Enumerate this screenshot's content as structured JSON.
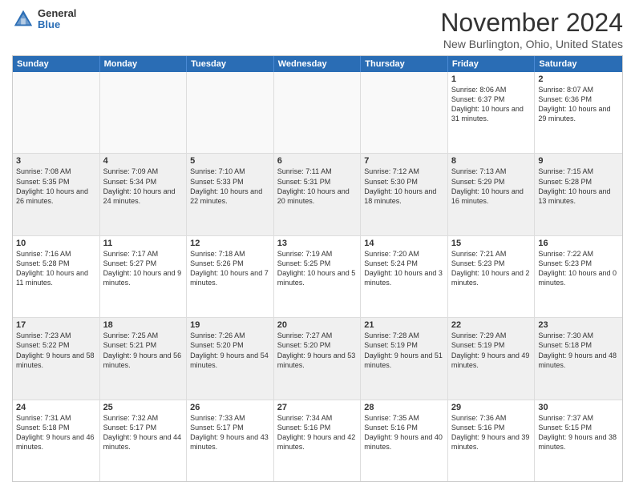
{
  "header": {
    "logo_general": "General",
    "logo_blue": "Blue",
    "month_title": "November 2024",
    "location": "New Burlington, Ohio, United States"
  },
  "calendar": {
    "days_of_week": [
      "Sunday",
      "Monday",
      "Tuesday",
      "Wednesday",
      "Thursday",
      "Friday",
      "Saturday"
    ],
    "rows": [
      [
        {
          "day": "",
          "empty": true
        },
        {
          "day": "",
          "empty": true
        },
        {
          "day": "",
          "empty": true
        },
        {
          "day": "",
          "empty": true
        },
        {
          "day": "",
          "empty": true
        },
        {
          "day": "1",
          "sunrise": "8:06 AM",
          "sunset": "6:37 PM",
          "daylight": "10 hours and 31 minutes."
        },
        {
          "day": "2",
          "sunrise": "8:07 AM",
          "sunset": "6:36 PM",
          "daylight": "10 hours and 29 minutes."
        }
      ],
      [
        {
          "day": "3",
          "sunrise": "7:08 AM",
          "sunset": "5:35 PM",
          "daylight": "10 hours and 26 minutes."
        },
        {
          "day": "4",
          "sunrise": "7:09 AM",
          "sunset": "5:34 PM",
          "daylight": "10 hours and 24 minutes."
        },
        {
          "day": "5",
          "sunrise": "7:10 AM",
          "sunset": "5:33 PM",
          "daylight": "10 hours and 22 minutes."
        },
        {
          "day": "6",
          "sunrise": "7:11 AM",
          "sunset": "5:31 PM",
          "daylight": "10 hours and 20 minutes."
        },
        {
          "day": "7",
          "sunrise": "7:12 AM",
          "sunset": "5:30 PM",
          "daylight": "10 hours and 18 minutes."
        },
        {
          "day": "8",
          "sunrise": "7:13 AM",
          "sunset": "5:29 PM",
          "daylight": "10 hours and 16 minutes."
        },
        {
          "day": "9",
          "sunrise": "7:15 AM",
          "sunset": "5:28 PM",
          "daylight": "10 hours and 13 minutes."
        }
      ],
      [
        {
          "day": "10",
          "sunrise": "7:16 AM",
          "sunset": "5:28 PM",
          "daylight": "10 hours and 11 minutes."
        },
        {
          "day": "11",
          "sunrise": "7:17 AM",
          "sunset": "5:27 PM",
          "daylight": "10 hours and 9 minutes."
        },
        {
          "day": "12",
          "sunrise": "7:18 AM",
          "sunset": "5:26 PM",
          "daylight": "10 hours and 7 minutes."
        },
        {
          "day": "13",
          "sunrise": "7:19 AM",
          "sunset": "5:25 PM",
          "daylight": "10 hours and 5 minutes."
        },
        {
          "day": "14",
          "sunrise": "7:20 AM",
          "sunset": "5:24 PM",
          "daylight": "10 hours and 3 minutes."
        },
        {
          "day": "15",
          "sunrise": "7:21 AM",
          "sunset": "5:23 PM",
          "daylight": "10 hours and 2 minutes."
        },
        {
          "day": "16",
          "sunrise": "7:22 AM",
          "sunset": "5:23 PM",
          "daylight": "10 hours and 0 minutes."
        }
      ],
      [
        {
          "day": "17",
          "sunrise": "7:23 AM",
          "sunset": "5:22 PM",
          "daylight": "9 hours and 58 minutes."
        },
        {
          "day": "18",
          "sunrise": "7:25 AM",
          "sunset": "5:21 PM",
          "daylight": "9 hours and 56 minutes."
        },
        {
          "day": "19",
          "sunrise": "7:26 AM",
          "sunset": "5:20 PM",
          "daylight": "9 hours and 54 minutes."
        },
        {
          "day": "20",
          "sunrise": "7:27 AM",
          "sunset": "5:20 PM",
          "daylight": "9 hours and 53 minutes."
        },
        {
          "day": "21",
          "sunrise": "7:28 AM",
          "sunset": "5:19 PM",
          "daylight": "9 hours and 51 minutes."
        },
        {
          "day": "22",
          "sunrise": "7:29 AM",
          "sunset": "5:19 PM",
          "daylight": "9 hours and 49 minutes."
        },
        {
          "day": "23",
          "sunrise": "7:30 AM",
          "sunset": "5:18 PM",
          "daylight": "9 hours and 48 minutes."
        }
      ],
      [
        {
          "day": "24",
          "sunrise": "7:31 AM",
          "sunset": "5:18 PM",
          "daylight": "9 hours and 46 minutes."
        },
        {
          "day": "25",
          "sunrise": "7:32 AM",
          "sunset": "5:17 PM",
          "daylight": "9 hours and 44 minutes."
        },
        {
          "day": "26",
          "sunrise": "7:33 AM",
          "sunset": "5:17 PM",
          "daylight": "9 hours and 43 minutes."
        },
        {
          "day": "27",
          "sunrise": "7:34 AM",
          "sunset": "5:16 PM",
          "daylight": "9 hours and 42 minutes."
        },
        {
          "day": "28",
          "sunrise": "7:35 AM",
          "sunset": "5:16 PM",
          "daylight": "9 hours and 40 minutes."
        },
        {
          "day": "29",
          "sunrise": "7:36 AM",
          "sunset": "5:16 PM",
          "daylight": "9 hours and 39 minutes."
        },
        {
          "day": "30",
          "sunrise": "7:37 AM",
          "sunset": "5:15 PM",
          "daylight": "9 hours and 38 minutes."
        }
      ]
    ]
  }
}
